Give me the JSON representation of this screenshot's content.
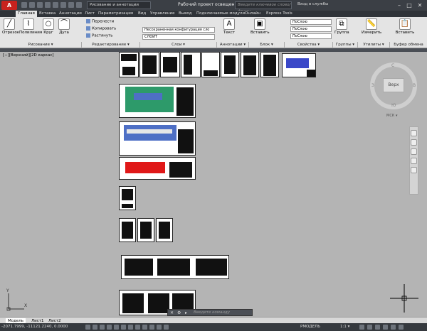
{
  "titlebar": {
    "workspace": "Рисование и аннотации",
    "document": "Рабочий проект освещения подстанц...",
    "search_placeholder": "Введите ключевое слово/фразу",
    "login": "Вход в службы"
  },
  "tabs": [
    "Главная",
    "Вставка",
    "Аннотации",
    "Лист",
    "Параметризация",
    "Вид",
    "Управление",
    "Вывод",
    "Подключаемые модули",
    "Онлайн",
    "Express Tools"
  ],
  "ribbon": {
    "draw": {
      "line": "Отрезок",
      "polyline": "Полилиния",
      "circle": "Круг",
      "arc": "Дуга"
    },
    "modify": {
      "move": "Перенести",
      "copy": "Копировать",
      "stretch": "Растянуть"
    },
    "layers": {
      "state": "Несохраненная конфигурация сло",
      "layer": "СЛОЙТ"
    },
    "annotation": {
      "text": "Текст"
    },
    "block": {
      "insert": "Вставить"
    },
    "properties": {
      "bylayer1": "ПоСлою",
      "bylayer2": "ПоСлою",
      "bylayer3": "ПоСлою"
    },
    "groups": {
      "group": "Группа"
    },
    "utilities": {
      "measure": "Измерить"
    },
    "clipboard": {
      "paste": "Вставить"
    },
    "panels": [
      "Рисование ▾",
      "Редактирование ▾",
      "Слои ▾",
      "Аннотации ▾",
      "Блок ▾",
      "Свойства ▾",
      "Группы ▾",
      "Утилиты ▾",
      "Буфер обмена"
    ]
  },
  "viewport": {
    "label": "[−][Верхний][2D каркас]"
  },
  "viewcube": {
    "face": "Верх",
    "north": "С",
    "south": "Ю",
    "west": "З",
    "east": "В",
    "ucs": "МСК ▾"
  },
  "ucs_icon": {
    "y": "Y",
    "x": "X"
  },
  "command": {
    "placeholder": "Введите команду"
  },
  "layouts": [
    "Модель",
    "Лист1",
    "Лист2"
  ],
  "status": {
    "coords": "-2071.7999, -11121.2240, 0.0000",
    "mode": "РМОДЕЛЬ",
    "scale": "1:1 ▾"
  },
  "colors": {
    "accent": "#c8221e",
    "ribbon_bg": "#e4e4e4",
    "canvas": "#b4b4b4",
    "titlebar": "#3b3f45"
  }
}
